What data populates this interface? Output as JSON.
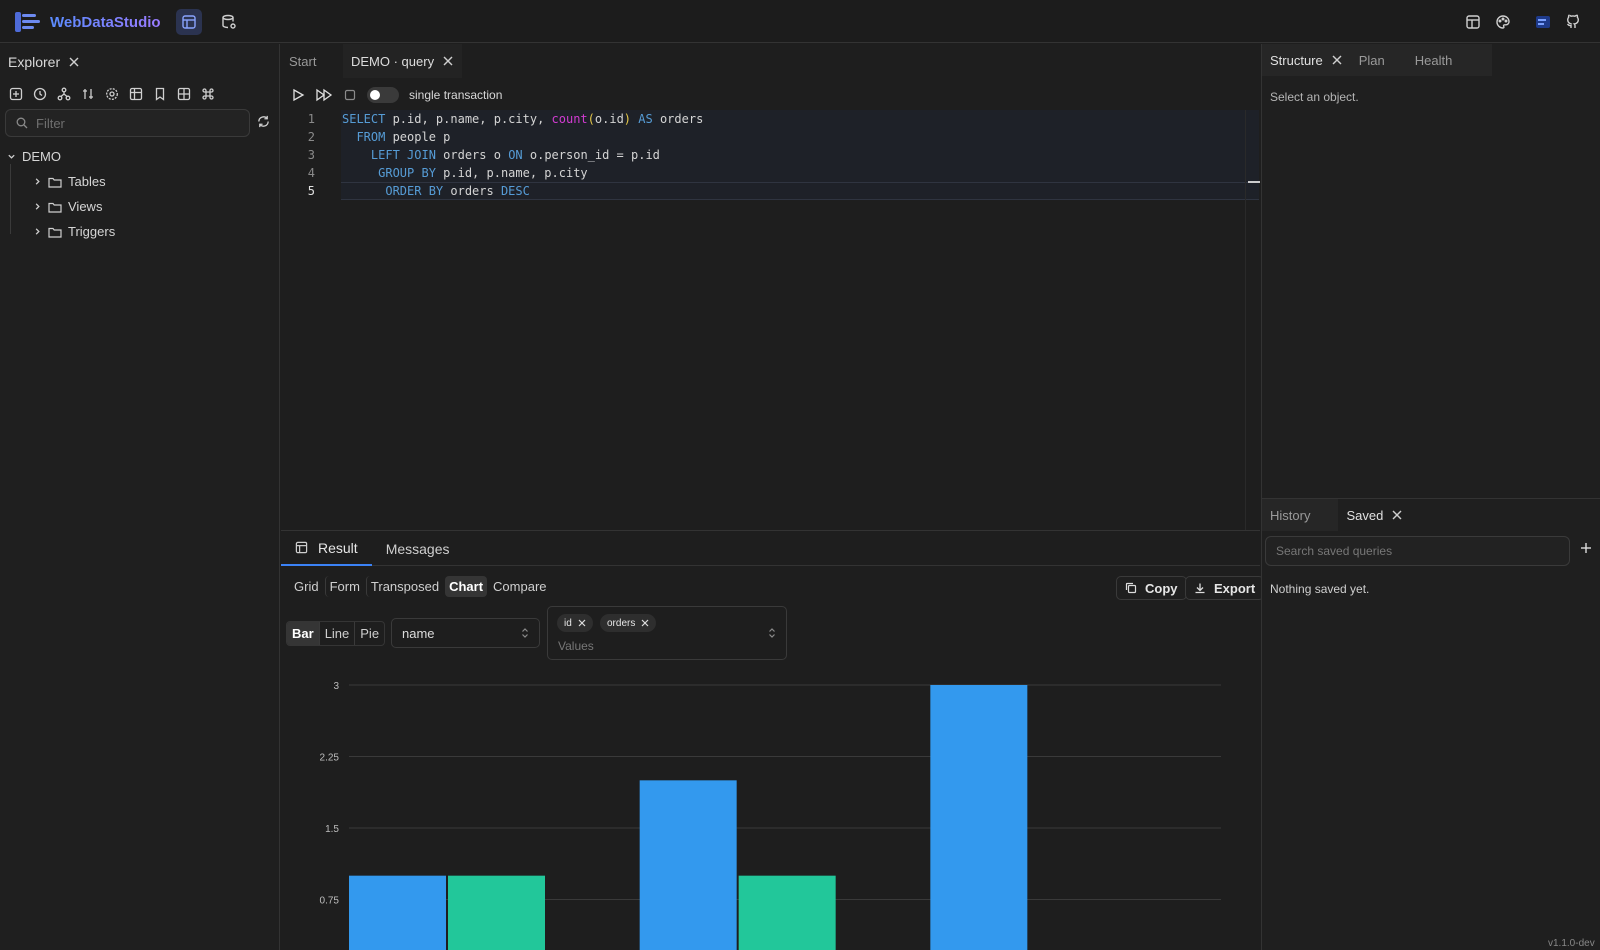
{
  "app": {
    "name": "WebDataStudio",
    "version": "v1.1.0-dev"
  },
  "explorer": {
    "title": "Explorer",
    "filter_placeholder": "Filter",
    "tree": {
      "root": "DEMO",
      "children": [
        "Tables",
        "Views",
        "Triggers"
      ]
    }
  },
  "editor": {
    "tabs": [
      "Start",
      "DEMO · query"
    ],
    "single_transaction_label": "single transaction",
    "line_numbers": [
      "1",
      "2",
      "3",
      "4",
      "5"
    ]
  },
  "result": {
    "tabs": [
      "Result",
      "Messages"
    ],
    "views": [
      "Grid",
      "Form",
      "Transposed",
      "Chart",
      "Compare"
    ],
    "active_view": "Chart",
    "copy_label": "Copy",
    "export_label": "Export",
    "chart_types": [
      "Bar",
      "Line",
      "Pie"
    ],
    "active_chart_type": "Bar",
    "category_select": "name",
    "value_chips": [
      "id",
      "orders"
    ],
    "values_placeholder": "Values"
  },
  "right_panel": {
    "top_tabs": [
      "Structure",
      "Plan",
      "Health"
    ],
    "structure_hint": "Select an object.",
    "bottom_tabs": [
      "History",
      "Saved"
    ],
    "saved_search_placeholder": "Search saved queries",
    "saved_empty": "Nothing saved yet."
  },
  "colors": {
    "accent": "#3b82f6",
    "series_id": "#3399ee",
    "series_orders": "#22c79a"
  },
  "chart_data": {
    "type": "bar",
    "ylim": [
      0,
      3
    ],
    "y_ticks": [
      "3",
      "2.25",
      "1.5",
      "0.75"
    ],
    "tick_values": [
      3,
      2.25,
      1.5,
      0.75
    ],
    "series": [
      {
        "name": "id",
        "values": [
          1,
          2,
          3
        ]
      },
      {
        "name": "orders",
        "values": [
          1,
          1,
          0
        ]
      }
    ]
  }
}
